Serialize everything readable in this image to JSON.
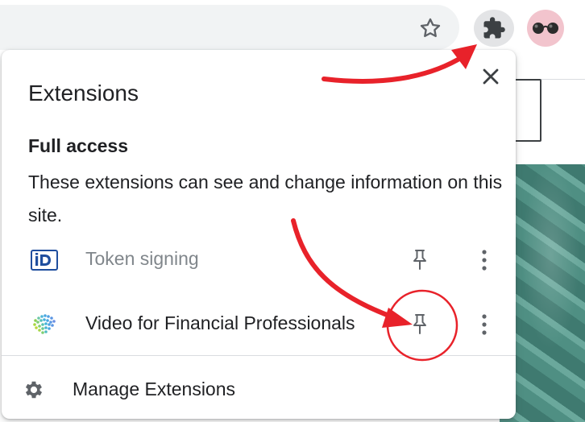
{
  "toolbar": {
    "bookmark_icon": "star-icon",
    "extensions_icon": "puzzle-icon",
    "profile_icon": "avatar-sunglasses"
  },
  "popup": {
    "title": "Extensions",
    "close_icon": "close-icon",
    "section": {
      "title": "Full access",
      "description": "These extensions can see and change information on this site."
    },
    "extensions": [
      {
        "name": "Token signing",
        "icon": "id-card-icon",
        "pin_icon": "pin-icon",
        "more_icon": "more-vert-icon"
      },
      {
        "name": "Video for Financial Professionals",
        "icon": "dotted-leaf-icon",
        "pin_icon": "pin-icon",
        "more_icon": "more-vert-icon"
      }
    ],
    "manage": {
      "label": "Manage Extensions",
      "icon": "gear-icon"
    }
  },
  "annotations": {
    "color": "#e8222a",
    "shapes": [
      "arrow",
      "arrow",
      "circle"
    ]
  },
  "colors": {
    "omnibox": "#f1f3f4",
    "primary_text": "#202124",
    "disabled_text": "#80868b",
    "icon_gray": "#5f6368"
  }
}
